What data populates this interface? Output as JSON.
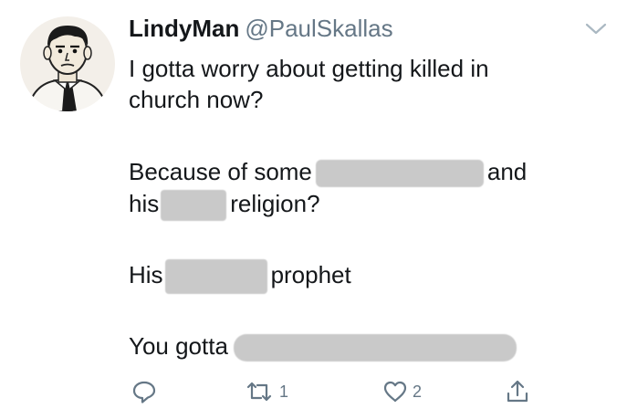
{
  "tweet": {
    "display_name": "LindyMan",
    "handle": "@PaulSkallas",
    "avatar_icon": "cartoon-man-avatar",
    "menu_icon": "chevron-down-icon",
    "lines": {
      "l1": "I gotta worry about getting killed in",
      "l2": "church now?",
      "l3a": "Because of some",
      "l3b": "and",
      "l4a": "his",
      "l4b": "religion?",
      "l5a": "His",
      "l5b": "prophet",
      "l6a": "You gotta"
    }
  },
  "actions": {
    "reply": {
      "icon": "reply-icon",
      "count": ""
    },
    "retweet": {
      "icon": "retweet-icon",
      "count": "1"
    },
    "like": {
      "icon": "heart-icon",
      "count": "2"
    },
    "share": {
      "icon": "share-icon"
    }
  },
  "colors": {
    "text": "#14171a",
    "secondary": "#657786",
    "redaction": "#c9c9c9"
  }
}
